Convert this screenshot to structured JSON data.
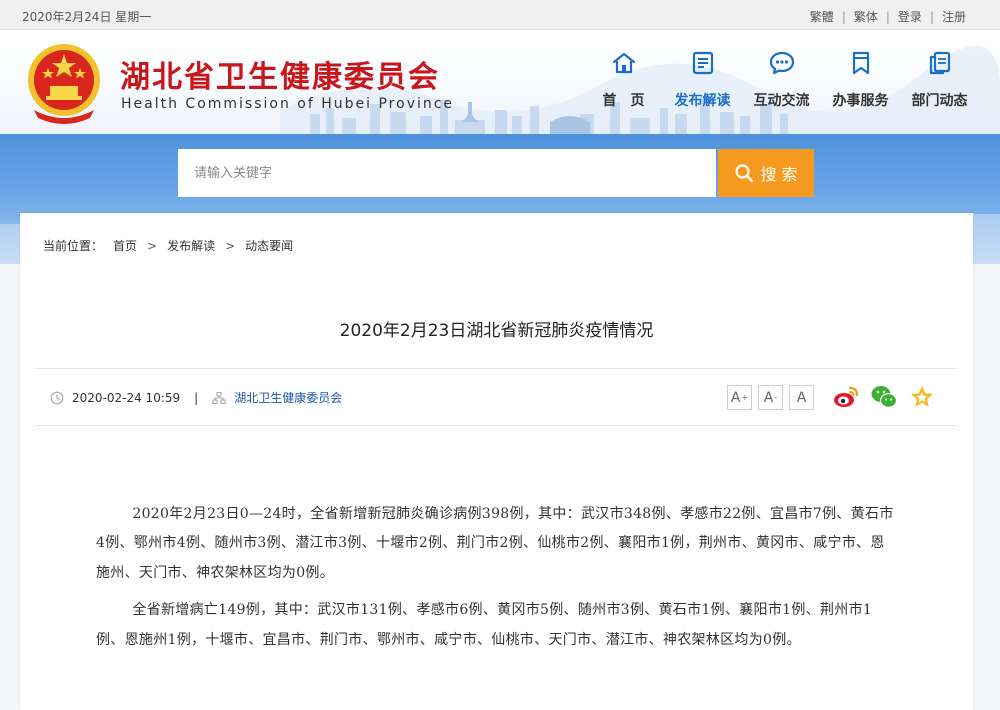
{
  "topbar": {
    "date": "2020年2月24日 星期一",
    "links": [
      "繁體",
      "繁体",
      "登录",
      "注册"
    ],
    "separator": "|"
  },
  "header": {
    "title": "湖北省卫生健康委员会",
    "subtitle": "Health Commission of Hubei Province",
    "nav": [
      {
        "label": "首　页",
        "icon": "home-icon"
      },
      {
        "label": "发布解读",
        "icon": "document-icon",
        "active": true
      },
      {
        "label": "互动交流",
        "icon": "chat-bubble-icon"
      },
      {
        "label": "办事服务",
        "icon": "bookmark-icon"
      },
      {
        "label": "部门动态",
        "icon": "copy-icon"
      }
    ]
  },
  "search": {
    "placeholder": "请输入关键字",
    "button_label": "搜 索"
  },
  "breadcrumb": {
    "prefix": "当前位置：",
    "items": [
      "首页",
      "发布解读",
      "动态要闻"
    ],
    "separator": ">"
  },
  "article": {
    "title": "2020年2月23日湖北省新冠肺炎疫情情况",
    "datetime": "2020-02-24 10:59",
    "meta_separator": "|",
    "source": "湖北卫生健康委员会",
    "font_controls": [
      "A",
      "A",
      "A"
    ],
    "font_superscripts": [
      "+",
      "",
      ""
    ],
    "font_subscripts": [
      "",
      "-",
      ""
    ],
    "share_icons": [
      "weibo-icon",
      "wechat-icon",
      "favorite-star-icon"
    ],
    "paragraphs": [
      "2020年2月23日0—24时，全省新增新冠肺炎确诊病例398例，其中：武汉市348例、孝感市22例、宜昌市7例、黄石市4例、鄂州市4例、随州市3例、潜江市3例、十堰市2例、荆门市2例、仙桃市2例、襄阳市1例，荆州市、黄冈市、咸宁市、恩施州、天门市、神农架林区均为0例。",
      "全省新增病亡149例，其中：武汉市131例、孝感市6例、黄冈市5例、随州市3例、黄石市1例、襄阳市1例、荆州市1例、恩施州1例，十堰市、宜昌市、荆门市、鄂州市、咸宁市、仙桃市、天门市、潜江市、神农架林区均为0例。"
    ]
  },
  "colors": {
    "brand_red": "#c8161d",
    "nav_active": "#1a6fc4",
    "search_button": "#f59a1e",
    "band_blue": "#4d91dd",
    "source_link": "#1a5aa6"
  }
}
